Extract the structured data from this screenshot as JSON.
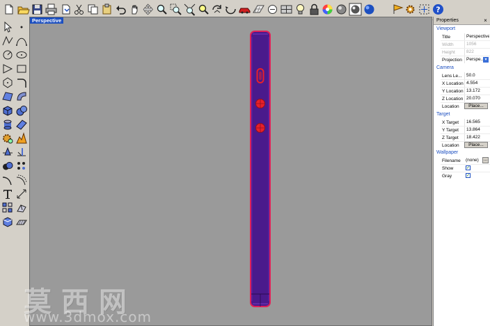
{
  "viewport": {
    "tab_label": "Perspective"
  },
  "properties": {
    "panel_title": "Properties",
    "close": "×",
    "viewport_section": "Viewport",
    "title_label": "Title",
    "title_value": "Perspective",
    "width_label": "Width",
    "width_value": "1056",
    "height_label": "Height",
    "height_value": "822",
    "projection_label": "Projection",
    "projection_value": "Perspe...",
    "camera_section": "Camera",
    "lens_label": "Lens Le...",
    "lens_value": "50.0",
    "x_loc_label": "X Location",
    "x_loc_value": "4.554",
    "y_loc_label": "Y Location",
    "y_loc_value": "13.172",
    "z_loc_label": "Z Location",
    "z_loc_value": "20.070",
    "cam_loc_label": "Location",
    "cam_place": "Place...",
    "target_section": "Target",
    "x_tgt_label": "X Target",
    "x_tgt_value": "16.565",
    "y_tgt_label": "Y Target",
    "y_tgt_value": "13.864",
    "z_tgt_label": "Z Target",
    "z_tgt_value": "18.422",
    "tgt_loc_label": "Location",
    "tgt_place": "Place...",
    "wallpaper_section": "Wallpaper",
    "filename_label": "Filename",
    "filename_value": "(none)",
    "show_label": "Show",
    "gray_label": "Gray",
    "check": "✓",
    "browse": "...",
    "drop": "▾"
  },
  "watermark": {
    "chinese": "莫西网",
    "url": "www.3dmox.com"
  },
  "colors": {
    "phone_body": "#4a1a8c",
    "phone_edge": "#e0205a",
    "button_red": "#e8202a",
    "viewport_bg": "#9a9a9a",
    "accent": "#1c4fc0"
  },
  "toolbar_icons": [
    "new-file-icon",
    "open-folder-icon",
    "save-icon",
    "print-icon",
    "import-icon",
    "cut-icon",
    "copy-icon",
    "paste-icon",
    "undo-icon",
    "pan-hand-icon",
    "move-icon",
    "zoom-icon",
    "zoom-window-icon",
    "zoom-extents-icon",
    "zoom-selected-icon",
    "rotate-view-icon",
    "car-icon",
    "grid-icon",
    "named-view-icon",
    "cplane-icon",
    "light-bulb-icon",
    "lock-icon",
    "color-wheel-icon",
    "shaded-sphere-icon",
    "render-icon",
    "globe-icon",
    "flag-icon",
    "gear-tools-icon",
    "snap-icon",
    "help-icon"
  ]
}
